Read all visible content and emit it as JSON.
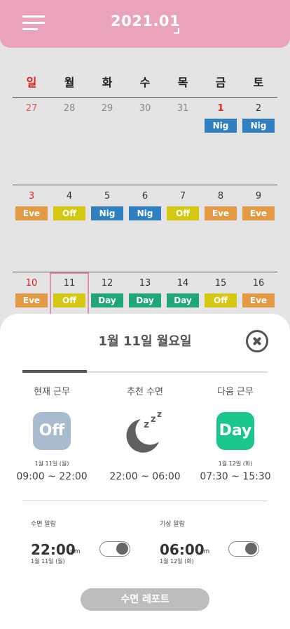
{
  "header": {
    "title": "2021.01"
  },
  "weekdays": [
    "일",
    "월",
    "화",
    "수",
    "목",
    "금",
    "토"
  ],
  "weeks": [
    {
      "days": [
        {
          "num": "27",
          "shift": ""
        },
        {
          "num": "28",
          "shift": ""
        },
        {
          "num": "29",
          "shift": ""
        },
        {
          "num": "30",
          "shift": ""
        },
        {
          "num": "31",
          "shift": ""
        },
        {
          "num": "1",
          "shift": "Nig"
        },
        {
          "num": "2",
          "shift": "Nig"
        }
      ]
    },
    {
      "days": [
        {
          "num": "3",
          "shift": "Eve"
        },
        {
          "num": "4",
          "shift": "Off"
        },
        {
          "num": "5",
          "shift": "Nig"
        },
        {
          "num": "6",
          "shift": "Nig"
        },
        {
          "num": "7",
          "shift": "Off"
        },
        {
          "num": "8",
          "shift": "Eve"
        },
        {
          "num": "9",
          "shift": "Eve"
        }
      ]
    },
    {
      "days": [
        {
          "num": "10",
          "shift": "Eve"
        },
        {
          "num": "11",
          "shift": "Off"
        },
        {
          "num": "12",
          "shift": "Day"
        },
        {
          "num": "13",
          "shift": "Day"
        },
        {
          "num": "14",
          "shift": "Day"
        },
        {
          "num": "15",
          "shift": "Off"
        },
        {
          "num": "16",
          "shift": "Eve"
        }
      ]
    }
  ],
  "colors": {
    "header": "#e9a3bd",
    "Nig": "#2f7fc1",
    "Eve": "#e49a44",
    "Off": "#d4c812",
    "Day": "#1ea67a"
  },
  "sheet": {
    "title": "1월 11일 월요일",
    "current": {
      "label": "현재 근무",
      "badge": "Off",
      "date": "1월 11일 (월)",
      "time": "09:00 ~ 22:00"
    },
    "sleep": {
      "label": "추천 수면",
      "icon": "moon-zzz-icon",
      "time": "22:00 ~ 06:00"
    },
    "next": {
      "label": "다음 근무",
      "badge": "Day",
      "date": "1월 12일 (화)",
      "time": "07:30 ~ 15:30"
    },
    "sleep_alarm": {
      "label": "수면 알람",
      "time": "22:00",
      "ampm": "pm",
      "date": "1월 11일 (월)",
      "enabled": true
    },
    "wake_alarm": {
      "label": "기상 알람",
      "time": "06:00",
      "ampm": "am",
      "date": "1월 12일 (화)",
      "enabled": true
    },
    "report_button": "수면 레포트"
  }
}
